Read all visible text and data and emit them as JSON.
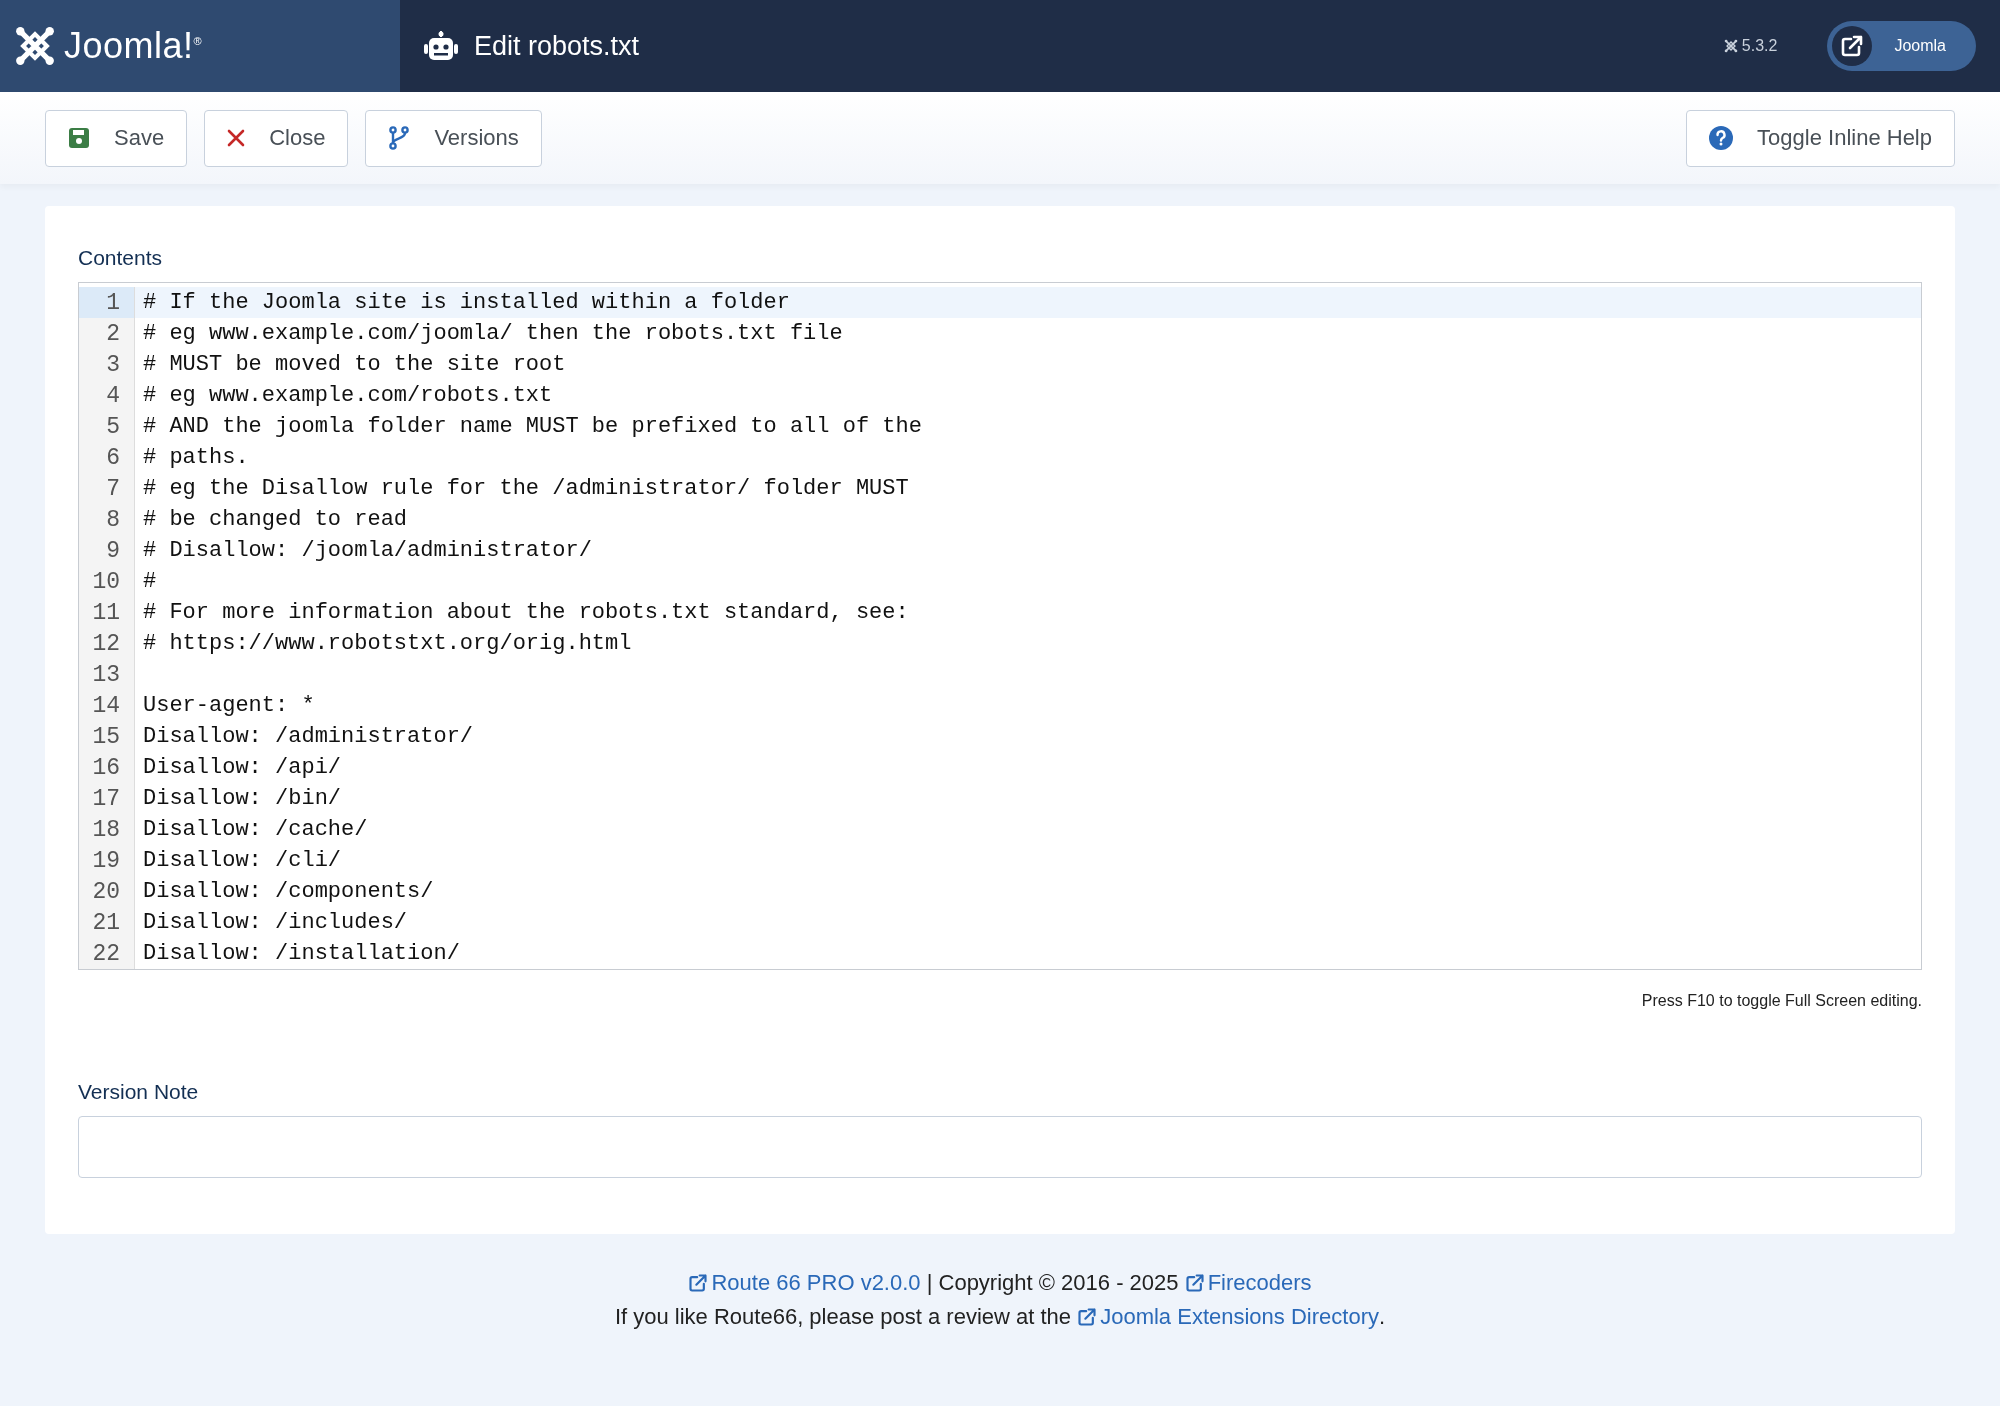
{
  "header": {
    "logo": "Joomla!$^{®}$",
    "title": "Edit robots.txt",
    "version": "5.3.2",
    "site_button": "Joomla"
  },
  "toolbar": {
    "buttons": [
      {
        "kind": "save",
        "label": "Save"
      },
      {
        "kind": "close",
        "label": "Close"
      },
      {
        "kind": "versions",
        "label": "Versions"
      }
    ],
    "help_button": "Toggle Inline Help"
  },
  "form": {
    "contents_label": "Contents",
    "editor": {
      "lines": [
        {
          "number": "1",
          "text": "# If the Joomla site is installed within a folder",
          "active": true
        },
        {
          "number": "2",
          "text": "# eg www.example.com/joomla/ then the robots.txt file",
          "active": false
        },
        {
          "number": "3",
          "text": "# MUST be moved to the site root",
          "active": false
        },
        {
          "number": "4",
          "text": "# eg www.example.com/robots.txt",
          "active": false
        },
        {
          "number": "5",
          "text": "# AND the joomla folder name MUST be prefixed to all of the",
          "active": false
        },
        {
          "number": "6",
          "text": "# paths.",
          "active": false
        },
        {
          "number": "7",
          "text": "# eg the Disallow rule for the /administrator/ folder MUST",
          "active": false
        },
        {
          "number": "8",
          "text": "# be changed to read",
          "active": false
        },
        {
          "number": "9",
          "text": "# Disallow: /joomla/administrator/",
          "active": false
        },
        {
          "number": "10",
          "text": "#",
          "active": false
        },
        {
          "number": "11",
          "text": "# For more information about the robots.txt standard, see:",
          "active": false
        },
        {
          "number": "12",
          "text": "# https://www.robotstxt.org/orig.html",
          "active": false
        },
        {
          "number": "13",
          "active": false
        },
        {
          "number": "14",
          "text": "User-agent: *",
          "active": false
        },
        {
          "number": "15",
          "text": "Disallow: /administrator/",
          "active": false
        },
        {
          "number": "16",
          "text": "Disallow: /api/",
          "active": false
        },
        {
          "number": "17",
          "text": "Disallow: /bin/",
          "active": false
        },
        {
          "number": "18",
          "text": "Disallow: /cache/",
          "active": false
        },
        {
          "number": "19",
          "text": "Disallow: /cli/",
          "active": false
        },
        {
          "number": "20",
          "text": "Disallow: /components/",
          "active": false
        },
        {
          "number": "21",
          "text": "Disallow: /includes/",
          "active": false
        },
        {
          "number": "22",
          "text": "Disallow: /installation/",
          "active": false
        }
      ]
    },
    "editor_hint": "Press F10 to toggle Full Screen editing.",
    "version_note_label": "Version Note"
  },
  "footer": {
    "lines": [
      [
        {
          "kind": "link",
          "text": "Route 66 PRO v2.0.0"
        },
        {
          "kind": "text",
          "text": " | Copyright © 2016 - 2025 "
        },
        {
          "kind": "link",
          "text": "Firecoders"
        }
      ],
      [
        {
          "kind": "text",
          "text": "If you like Route66, please post a review at the "
        },
        {
          "kind": "link",
          "text": "Joomla Extensions Directory"
        },
        {
          "kind": "text",
          "text": "."
        }
      ]
    ]
  }
}
